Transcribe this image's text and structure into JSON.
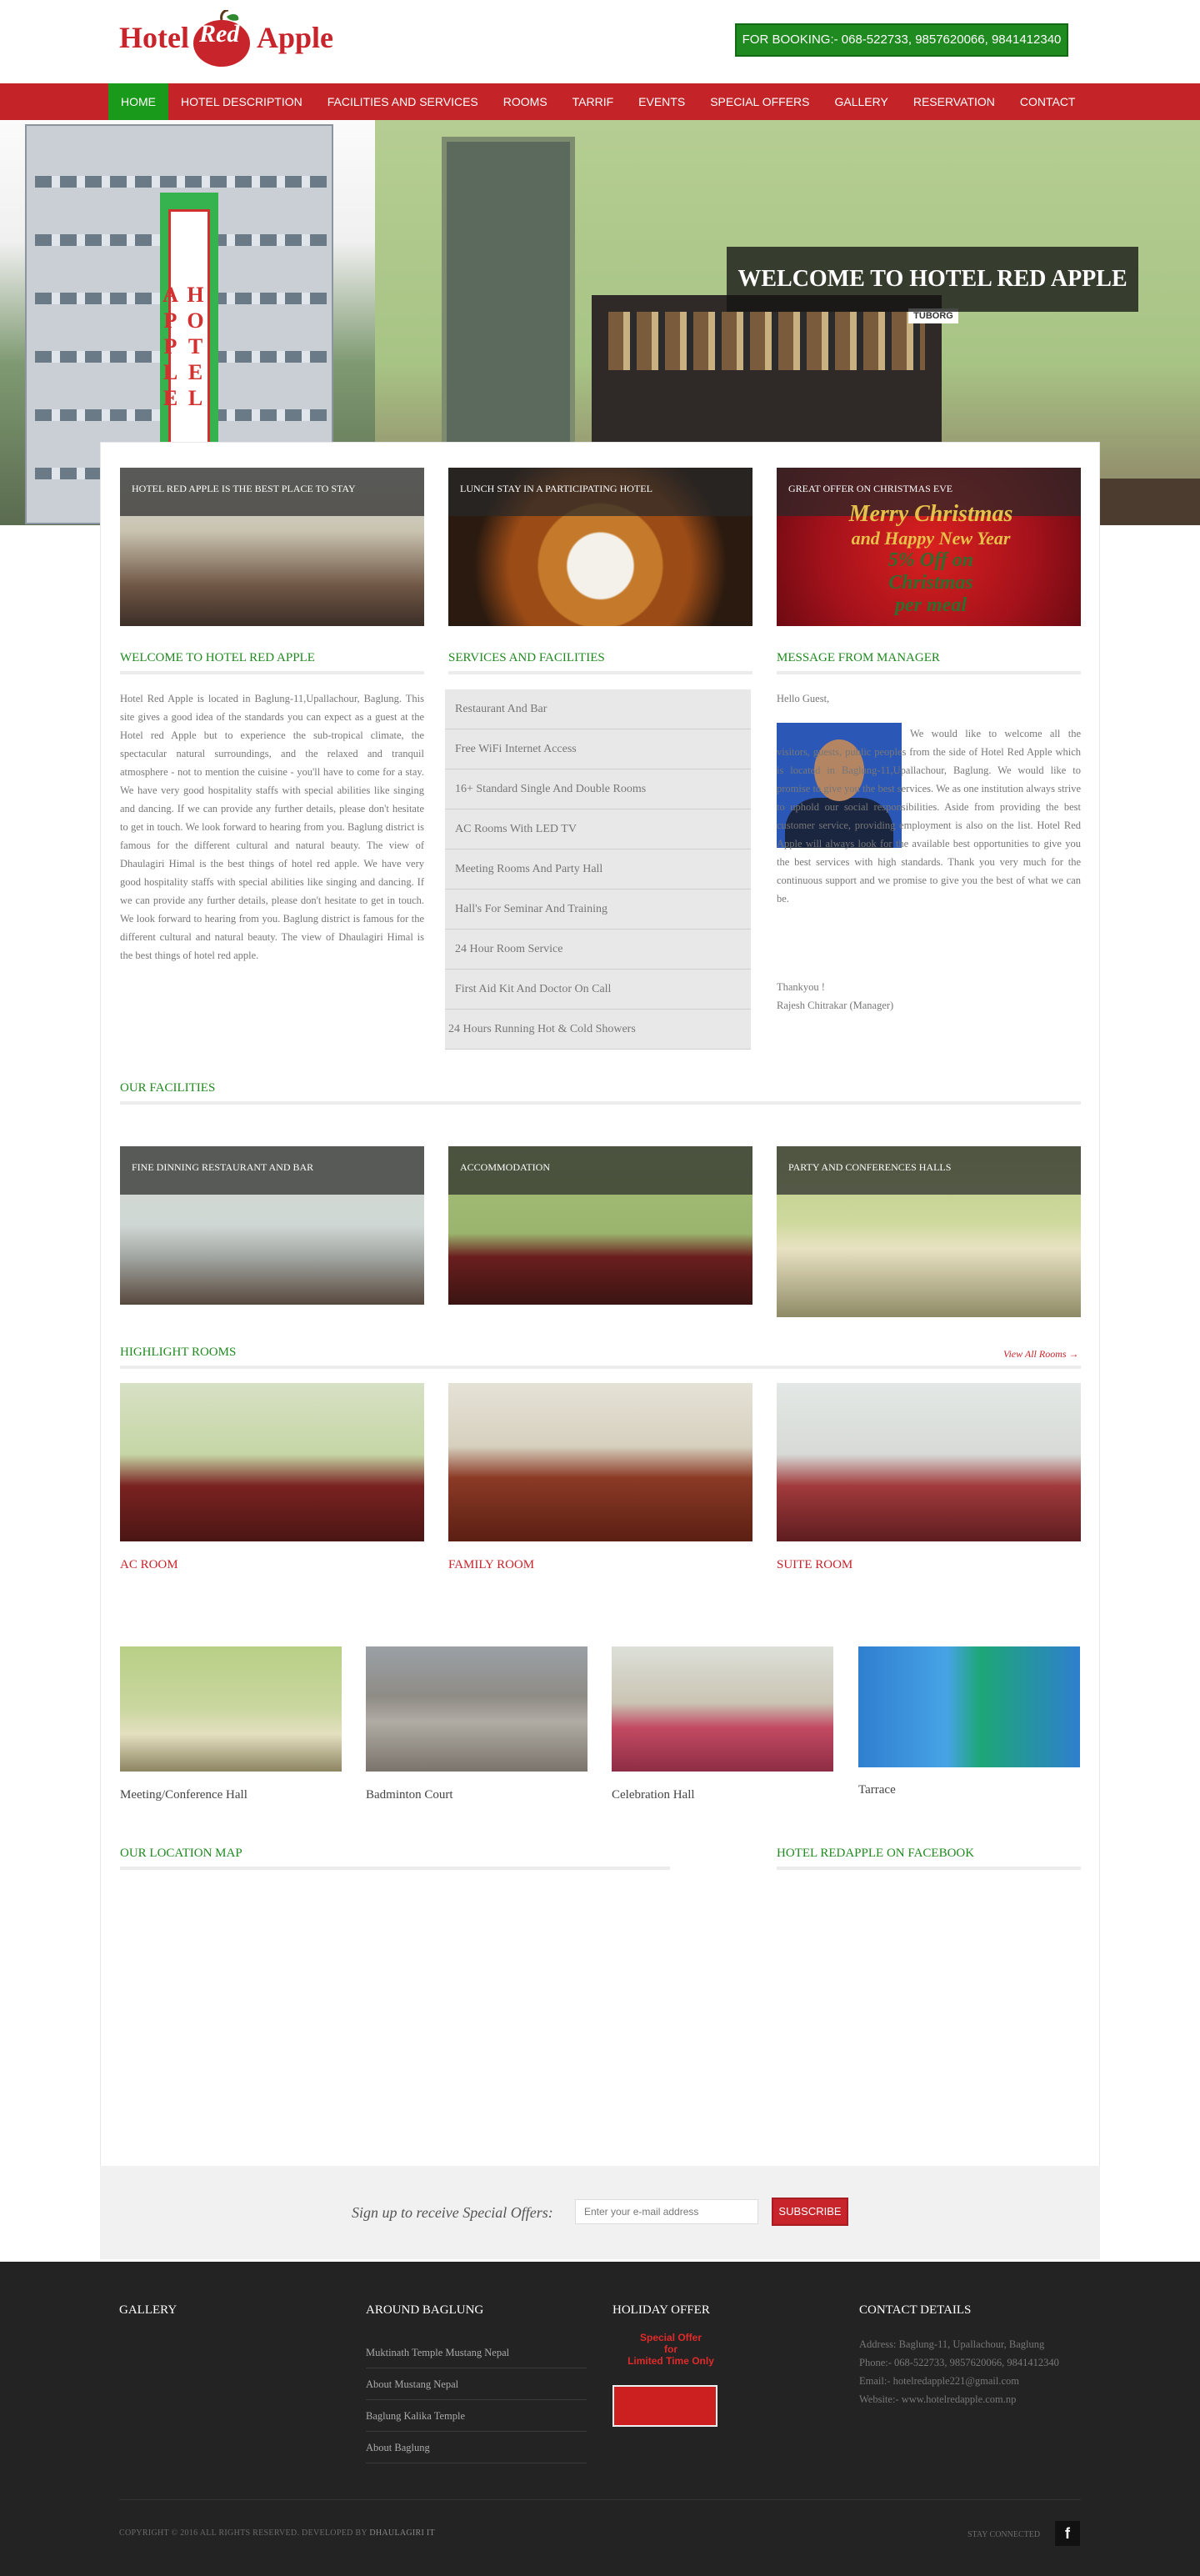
{
  "header": {
    "logo": {
      "w1": "Hotel",
      "w2": "Red",
      "w3": "Apple"
    },
    "booking": "FOR BOOKING:- 068-522733, 9857620066, 9841412340"
  },
  "nav": {
    "items": [
      {
        "label": "HOME",
        "active": true
      },
      {
        "label": "HOTEL DESCRIPTION"
      },
      {
        "label": "FACILITIES AND SERVICES"
      },
      {
        "label": "ROOMS"
      },
      {
        "label": "TARRIF"
      },
      {
        "label": "EVENTS"
      },
      {
        "label": "SPECIAL OFFERS"
      },
      {
        "label": "GALLERY"
      },
      {
        "label": "RESERVATION"
      },
      {
        "label": "CONTACT"
      }
    ]
  },
  "hero": {
    "title": "WELCOME TO HOTEL RED APPLE",
    "sign": "HOTEL APPLE",
    "brand": "TUBORG"
  },
  "feature_cards": [
    {
      "caption": "HOTEL RED APPLE IS THE BEST PLACE TO STAY"
    },
    {
      "caption": "LUNCH STAY IN A PARTICIPATING HOTEL"
    },
    {
      "caption": "GREAT OFFER ON CHRISTMAS EVE",
      "art": {
        "l1": "Merry Christmas",
        "l2": "and Happy New Year",
        "l3": "5% Off on",
        "l4": "Christmas",
        "l5": "per meal"
      }
    }
  ],
  "welcome": {
    "title": "WELCOME TO HOTEL RED APPLE",
    "text": "Hotel Red Apple is located in Baglung-11,Upallachour, Baglung. This site gives a good idea of the standards you can expect as a guest at the Hotel red Apple but to experience the sub-tropical climate, the spectacular natural surroundings, and the relaxed and tranquil atmosphere - not to mention the cuisine - you'll have to come for a stay. We have very good hospitality staffs with special abilities like singing and dancing. If we can provide any further details, please don't hesitate to get in touch. We look forward to hearing from you. Baglung district is famous for the different cultural and natural beauty. The view of Dhaulagiri Himal is the best things of hotel red apple. We have very good hospitality staffs with special abilities like singing and dancing. If we can provide any further details, please don't hesitate to get in touch. We look forward to hearing from you. Baglung district is famous for the different cultural and natural beauty. The view of Dhaulagiri Himal is the best things of hotel red apple."
  },
  "services": {
    "title": "SERVICES AND FACILITIES",
    "items": [
      "Restaurant And Bar",
      "Free WiFi Internet Access",
      "16+ Standard Single And Double Rooms",
      "AC Rooms With LED TV",
      "Meeting Rooms And Party Hall",
      "Hall's For Seminar And Training",
      "24 Hour Room Service",
      "First Aid Kit And Doctor On Call",
      "24 Hours Running Hot & Cold Showers"
    ]
  },
  "manager": {
    "title": "MESSAGE FROM MANAGER",
    "greeting": "Hello Guest,",
    "text": "We would like to welcome all the visitors, guests, public peoples from the side of Hotel Red Apple which is located in Baglung-11,Upallachour, Baglung. We would like to promise to give you the best services. We as one institution always strive to uphold our social responsibilities. Aside from providing the best customer service, providing employment is also on the list. Hotel Red Apple will always look for the available best opportunities to give you the best services with high standards. Thank you very much for the continuous support and we promise to give you the best of what we can be.",
    "thanks": "Thankyou !",
    "signature": "Rajesh Chitrakar (Manager)"
  },
  "facilities": {
    "title": "OUR FACILITIES",
    "items": [
      {
        "caption": "FINE DINNING RESTAURANT AND BAR"
      },
      {
        "caption": "ACCOMMODATION"
      },
      {
        "caption": "PARTY AND CONFERENCES HALLS"
      }
    ]
  },
  "rooms": {
    "title": "HIGHLIGHT ROOMS",
    "view_all": "View All Rooms →",
    "items": [
      {
        "name": "AC ROOM"
      },
      {
        "name": "FAMILY ROOM"
      },
      {
        "name": "SUITE ROOM"
      }
    ]
  },
  "halls": [
    {
      "name": "Meeting/Conference Hall"
    },
    {
      "name": "Badminton Court"
    },
    {
      "name": "Celebration Hall"
    },
    {
      "name": "Tarrace"
    }
  ],
  "location": {
    "title": "OUR LOCATION MAP"
  },
  "facebook": {
    "title": "HOTEL REDAPPLE ON FACEBOOK"
  },
  "subscribe": {
    "label": "Sign up to receive Special Offers:",
    "placeholder": "Enter your e-mail address",
    "button": "SUBSCRIBE"
  },
  "footer": {
    "gallery_title": "GALLERY",
    "around_title": "AROUND BAGLUNG",
    "around_links": [
      "Muktinath Temple Mustang Nepal",
      "About Mustang Nepal",
      "Baglung Kalika Temple",
      "About Baglung"
    ],
    "holiday_title": "HOLIDAY OFFER",
    "holiday_badge": [
      "Special Offer",
      "for",
      "Limited Time Only"
    ],
    "contact_title": "CONTACT DETAILS",
    "contact": {
      "address": "Address: Baglung-11, Upallachour, Baglung",
      "phone": "Phone:- 068-522733, 9857620066, 9841412340",
      "email": "Email:- hotelredapple221@gmail.com",
      "website": "Website:- www.hotelredapple.com.np"
    },
    "copyright": "COPYRIGHT © 2016 ALL RIGHTS RESERVED. DEVELOPED BY",
    "developer": "DHAULAGIRI IT",
    "stay_connected": "STAY CONNECTED",
    "facebook_glyph": "f"
  }
}
